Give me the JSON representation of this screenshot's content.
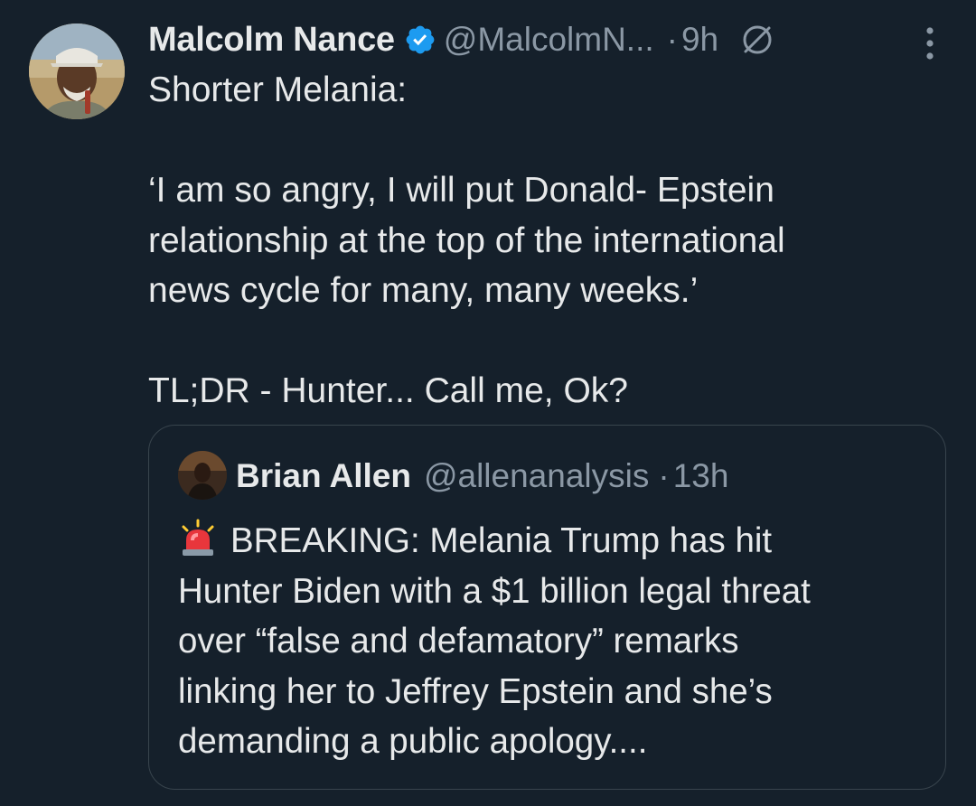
{
  "tweet": {
    "author": {
      "display_name": "Malcolm Nance",
      "handle": "@MalcolmN...",
      "verified": true
    },
    "separator": "·",
    "time": "9h",
    "lines": [
      "Shorter Melania:",
      "",
      "‘I am so angry, I will put Donald- Epstein",
      "relationship at the top of the international",
      "news cycle for many, many weeks.’",
      "",
      "TL;DR - Hunter... Call me, Ok?"
    ]
  },
  "quoted_tweet": {
    "author": {
      "display_name": "Brian Allen",
      "handle": "@allenanalysis"
    },
    "separator": "·",
    "time": "13h",
    "emoji": "siren-icon",
    "lines": [
      "BREAKING: Melania Trump has hit",
      "Hunter Biden with a $1 billion legal threat",
      "over “false and defamatory” remarks",
      "linking her to Jeffrey Epstein and she’s",
      "demanding a public apology...."
    ]
  },
  "colors": {
    "background": "#15202b",
    "text": "#e7e9ea",
    "secondary": "#8b98a5",
    "verified": "#1d9bf0",
    "border": "#38444d"
  }
}
